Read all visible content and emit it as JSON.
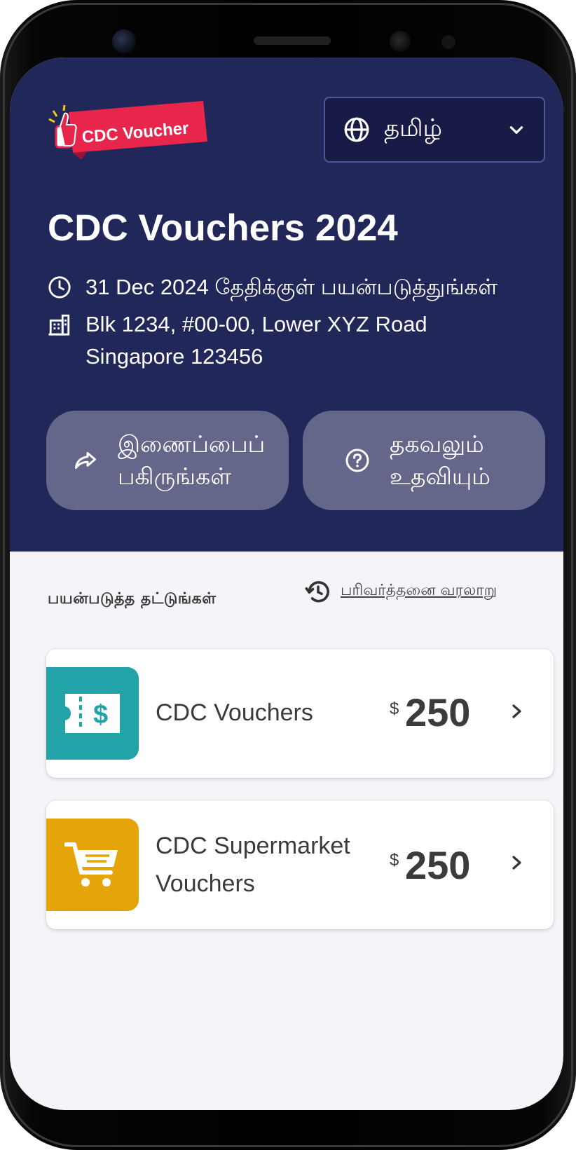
{
  "header": {
    "logo_text": "CDC Voucher",
    "language": {
      "selected": "தமிழ்",
      "icon": "globe-icon"
    },
    "title": "CDC Vouchers 2024",
    "expiry": {
      "icon": "clock-icon",
      "text": "31 Dec 2024 தேதிக்குள் பயன்படுத்துங்கள்"
    },
    "address": {
      "icon": "building-icon",
      "line1": "Blk 1234, #00-00, Lower XYZ Road",
      "line2": "Singapore 123456"
    },
    "actions": [
      {
        "icon": "share-icon",
        "label": "இணைப்பைப்\nபகிருங்கள்"
      },
      {
        "icon": "help-icon",
        "label": "தகவலும்\nஉதவியும்"
      }
    ]
  },
  "main": {
    "section_title": "பயன்படுத்த தட்டுங்கள்",
    "history_link": {
      "icon": "history-icon",
      "label": "பரிவர்த்தனை வரலாறு"
    },
    "vouchers": [
      {
        "icon": "voucher-ticket-icon",
        "name": "CDC Vouchers",
        "currency": "$",
        "amount": "250",
        "color": "#21a3a8"
      },
      {
        "icon": "shopping-cart-icon",
        "name": "CDC Supermarket Vouchers",
        "currency": "$",
        "amount": "250",
        "color": "#e5a50a"
      }
    ]
  },
  "colors": {
    "header_bg": "#22275a",
    "action_bg": "#64668a",
    "content_bg": "#f4f5f9",
    "logo_red": "#e8264b"
  }
}
